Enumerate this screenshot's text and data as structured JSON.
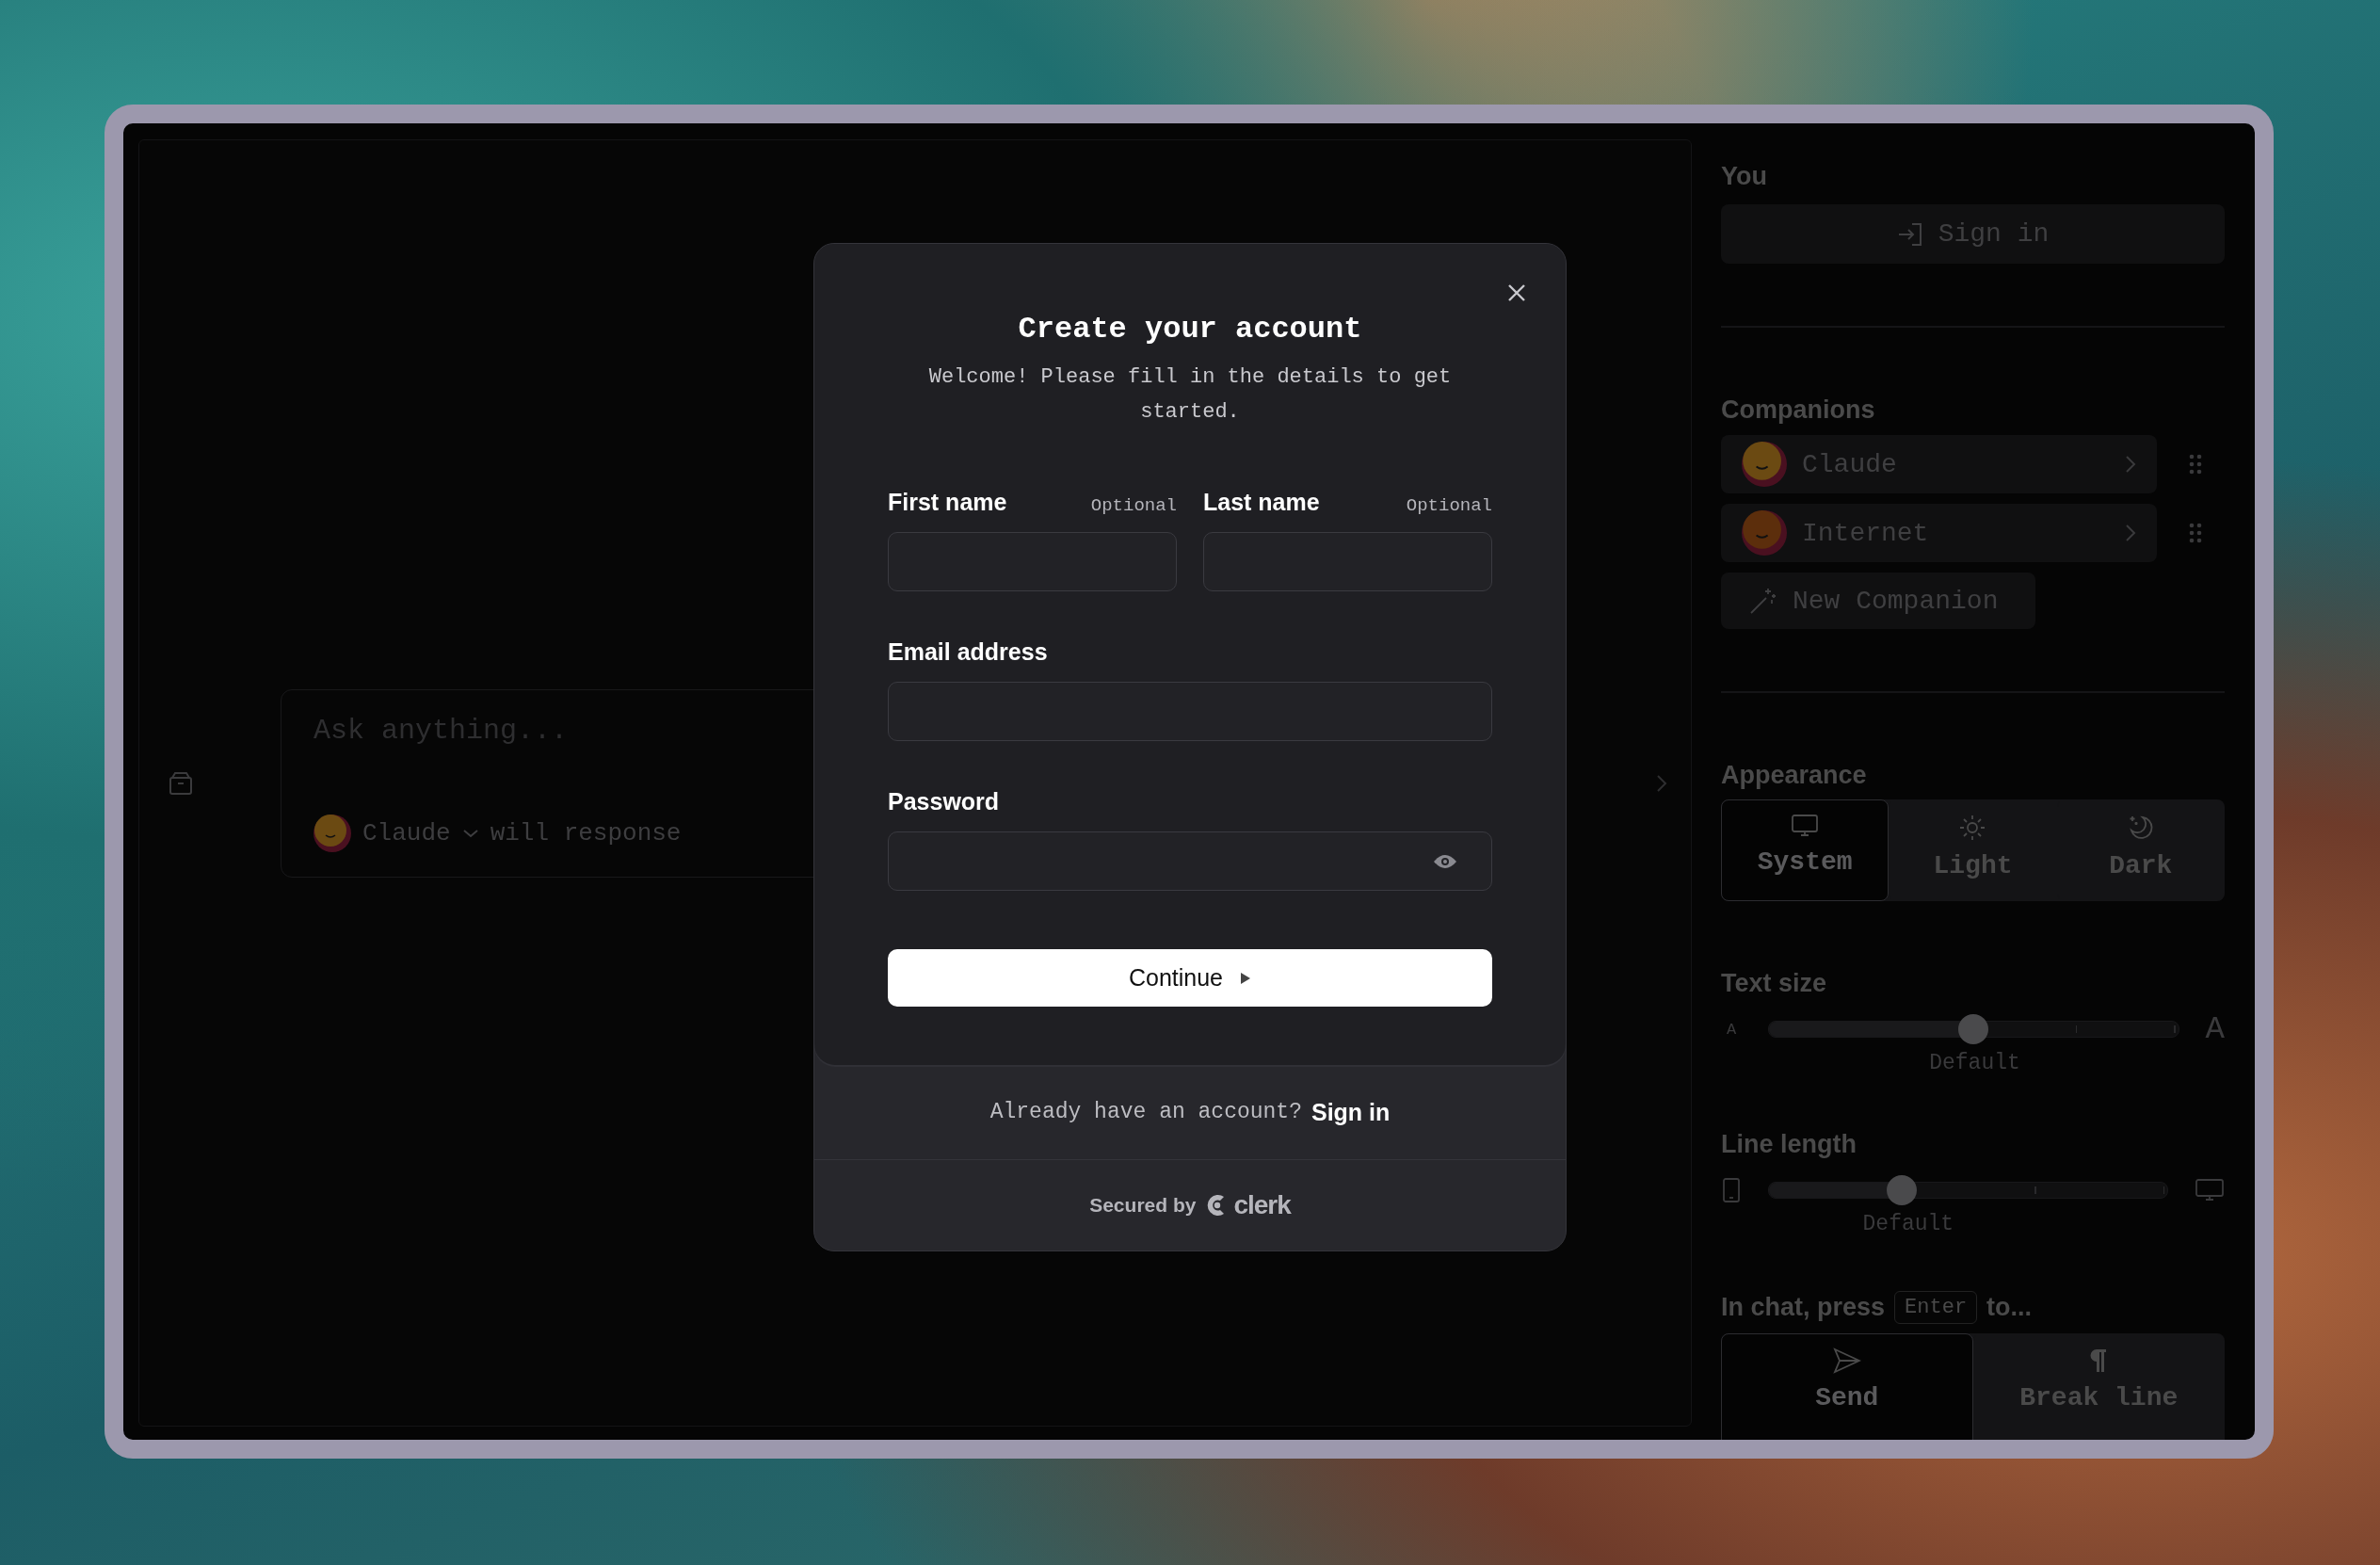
{
  "chat": {
    "composer": {
      "placeholder": "Ask anything...",
      "companion": "Claude",
      "suffix": "will response"
    }
  },
  "sidebar": {
    "you": {
      "heading": "You",
      "sign_in": "Sign in"
    },
    "companions": {
      "heading": "Companions",
      "items": [
        {
          "name": "Claude",
          "color": "#6b4a12"
        },
        {
          "name": "Internet",
          "color": "#5c2e0c"
        }
      ],
      "new_button": "New Companion"
    },
    "appearance": {
      "heading": "Appearance",
      "options": [
        {
          "label": "System",
          "kind": "monitor",
          "selected": true
        },
        {
          "label": "Light",
          "kind": "sun",
          "selected": false
        },
        {
          "label": "Dark",
          "kind": "moon",
          "selected": false
        }
      ]
    },
    "text_size": {
      "heading": "Text size",
      "small_glyph": "A",
      "large_glyph": "A",
      "level": 0.5,
      "caption": "Default"
    },
    "line_length": {
      "heading": "Line length",
      "level": 0.333,
      "caption": "Default"
    },
    "enter_behavior": {
      "heading_before": "In chat, press",
      "key": "Enter",
      "heading_after": "to...",
      "options": [
        {
          "label": "Send",
          "kind": "send",
          "selected": true
        },
        {
          "label": "Break line",
          "kind": "pilcrow",
          "selected": false
        }
      ]
    }
  },
  "modal": {
    "title": "Create your account",
    "subtitle": "Welcome! Please fill in the details to get started.",
    "rows": [
      {
        "fields": [
          {
            "label": "First name",
            "hint": "Optional",
            "kind": "text"
          },
          {
            "label": "Last name",
            "hint": "Optional",
            "kind": "text"
          }
        ]
      },
      {
        "fields": [
          {
            "label": "Email address",
            "kind": "text"
          }
        ]
      },
      {
        "fields": [
          {
            "label": "Password",
            "kind": "password"
          }
        ]
      }
    ],
    "continue": "Continue",
    "footer": {
      "prompt": "Already have an account?",
      "link": "Sign in"
    },
    "secured": {
      "text": "Secured by",
      "brand": "clerk"
    }
  }
}
